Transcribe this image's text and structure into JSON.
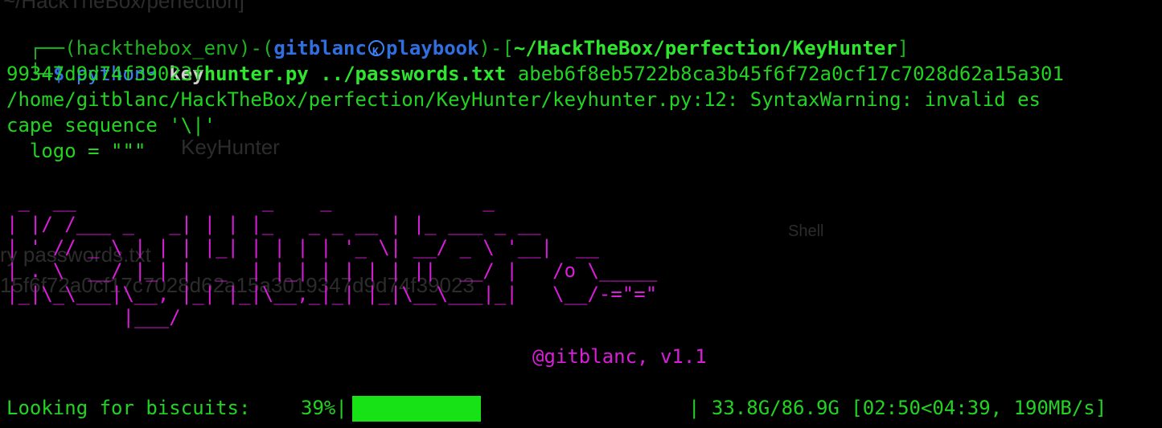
{
  "ghost": {
    "path_fragment": "~/HackTheBox/perfection]",
    "script_fragment": "KeyHunter",
    "shell_fragment": "Shell",
    "pw_fragment": "ry passwords.txt",
    "hash_fragment": "15f6f72a0cf17c7028d62a15a3019347d9d74f39023"
  },
  "prompt": {
    "open": "┌──(",
    "env": "hackthebox_env",
    "mid": ")-(",
    "user": "gitblanc",
    "host": "playbook",
    "close_open": ")-[",
    "cwd": "~/HackTheBox/perfection/KeyHunter",
    "close": "]",
    "corner": "└─",
    "dollar": "$",
    "cmd": "python3",
    "script_prefix": "key",
    "script_suffix": "hunter.py",
    "arg_file": "../passwords.txt",
    "hash_part1": "abeb6f8eb5722b8ca3b45f6f72a0cf17c7028d62a15a301",
    "hash_part2": "99347d9d74f39023f"
  },
  "warning": {
    "line1": "/home/gitblanc/HackTheBox/perfection/KeyHunter/keyhunter.py:12: SyntaxWarning: invalid es",
    "line2": "cape sequence '\\|'",
    "line3": "  logo = \"\"\""
  },
  "banner": {
    "ascii": " _  __                _    _             _\n| |/ /___ _   _| | | |_   _ _ __ | |_ ___ _ __\n| ' // _ \\ | | | |_| | | | | '_ \\| __/ _ \\ '__|  __\n| . \\  __/ |_| |  _  | |_| | | | | ||  __/ |   /o \\_____\n|_|\\_\\___|\\__, |_| |_|\\__,_|_| |_|\\__\\___|_|   \\__/-=\"=\"\n          |___/",
    "credit": "@gitblanc, v1.1"
  },
  "progress": {
    "label": "Looking for biscuits:",
    "percent_text": "39%|",
    "percent": 39,
    "stats": "| 33.8G/86.9G [02:50<04:39, 190MB/s]"
  },
  "colors": {
    "background": "#000000",
    "green": "#22d322",
    "blue": "#3b82f6",
    "magenta": "#d81ed8",
    "bar_fill": "#16e216"
  }
}
